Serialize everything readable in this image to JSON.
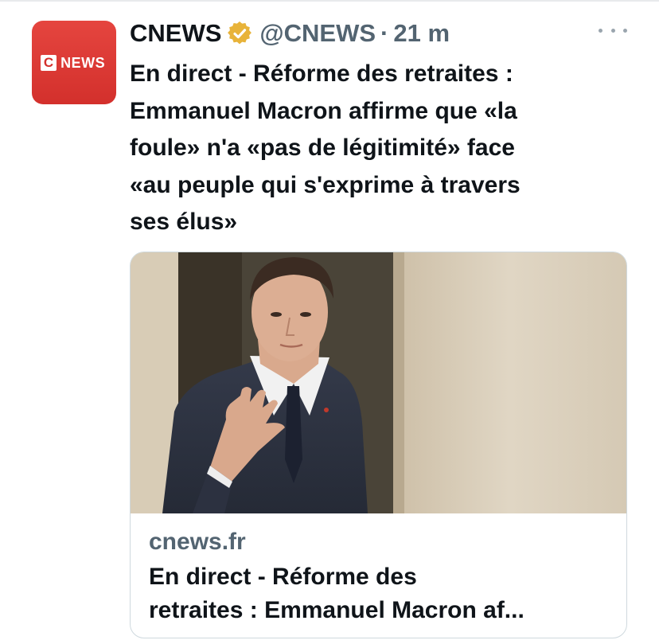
{
  "tweet": {
    "author_name": "CNEWS",
    "handle": "@CNEWS",
    "separator": "·",
    "time": "21 m",
    "avatar_logo": {
      "c": "C",
      "news": "NEWS"
    },
    "verified_icon": "verified-badge-icon",
    "text_lines": [
      "En direct - Réforme des retraites :",
      "Emmanuel Macron affirme que «la",
      "foule» n'a «pas de légitimité» face",
      "«au peuple qui s'exprime à travers",
      "ses élus»"
    ]
  },
  "card": {
    "domain": "cnews.fr",
    "title_lines": [
      "En direct - Réforme des",
      "retraites : Emmanuel Macron af..."
    ]
  },
  "colors": {
    "brand_red": "#d3302c",
    "verified_gold": "#e8b339",
    "secondary_text": "#536471",
    "primary_text": "#0f1419"
  }
}
